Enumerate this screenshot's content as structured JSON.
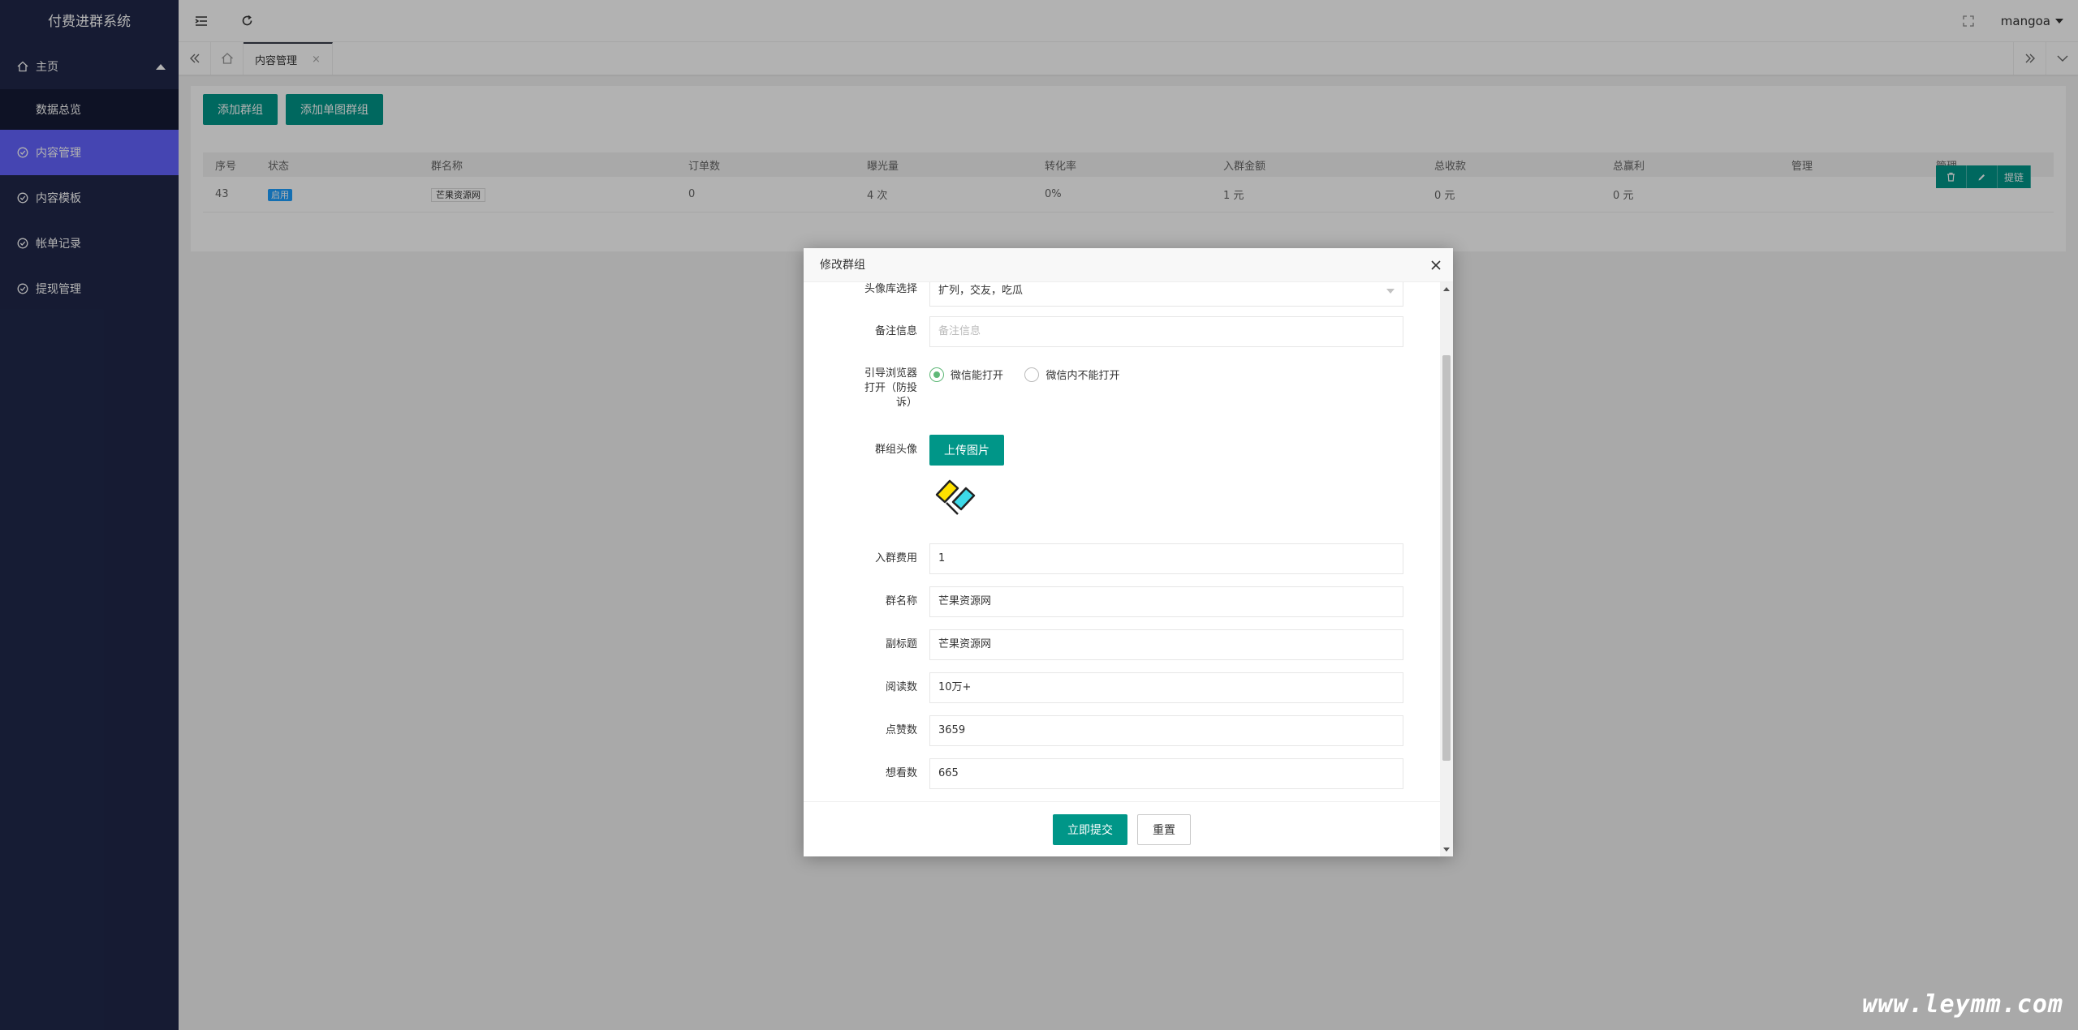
{
  "app": {
    "title": "付费进群系统"
  },
  "sidebar": {
    "home_label": "主页",
    "dashboard_label": "数据总览",
    "items": [
      {
        "label": "内容管理",
        "active": true
      },
      {
        "label": "内容模板"
      },
      {
        "label": "帐单记录"
      },
      {
        "label": "提现管理"
      }
    ]
  },
  "header": {
    "username": "mangoa"
  },
  "tabs": {
    "active_tab": "内容管理",
    "close_glyph": "×"
  },
  "toolbar": {
    "add_group_label": "添加群组",
    "add_single_label": "添加单图群组"
  },
  "table": {
    "headers": [
      "序号",
      "状态",
      "群名称",
      "订单数",
      "曝光量",
      "转化率",
      "入群金额",
      "总收款",
      "总赢利",
      "管理",
      "管理"
    ],
    "rows": [
      {
        "id": "43",
        "status": "启用",
        "name": "芒果资源网",
        "orders": "0",
        "exposure": "4 次",
        "conversion": "0%",
        "fee": "1 元",
        "total_income": "0 元",
        "total_profit": "0 元",
        "actions": {
          "delete_icon": "trash-icon",
          "edit_icon": "pencil-icon",
          "link_label": "提链"
        }
      }
    ]
  },
  "modal": {
    "title": "修改群组",
    "fields": {
      "avatar_lib_label": "头像库选择",
      "avatar_lib_value": "扩列，交友，吃瓜",
      "remark_label": "备注信息",
      "remark_placeholder": "备注信息",
      "guide_label_1": "引导浏览器",
      "guide_label_2": "打开（防投",
      "guide_label_3": "诉）",
      "guide_option_on": "微信能打开",
      "guide_option_off": "微信内不能打开",
      "avatar_label": "群组头像",
      "upload_label": "上传图片",
      "fee_label": "入群费用",
      "fee_value": "1",
      "name_label": "群名称",
      "name_value": "芒果资源网",
      "subtitle_label": "副标题",
      "subtitle_value": "芒果资源网",
      "reads_label": "阅读数",
      "reads_value": "10万+",
      "likes_label": "点赞数",
      "likes_value": "3659",
      "wants_label": "想看数",
      "wants_value": "665"
    },
    "submit_label": "立即提交",
    "reset_label": "重置"
  },
  "watermark": "www.leymm.com"
}
